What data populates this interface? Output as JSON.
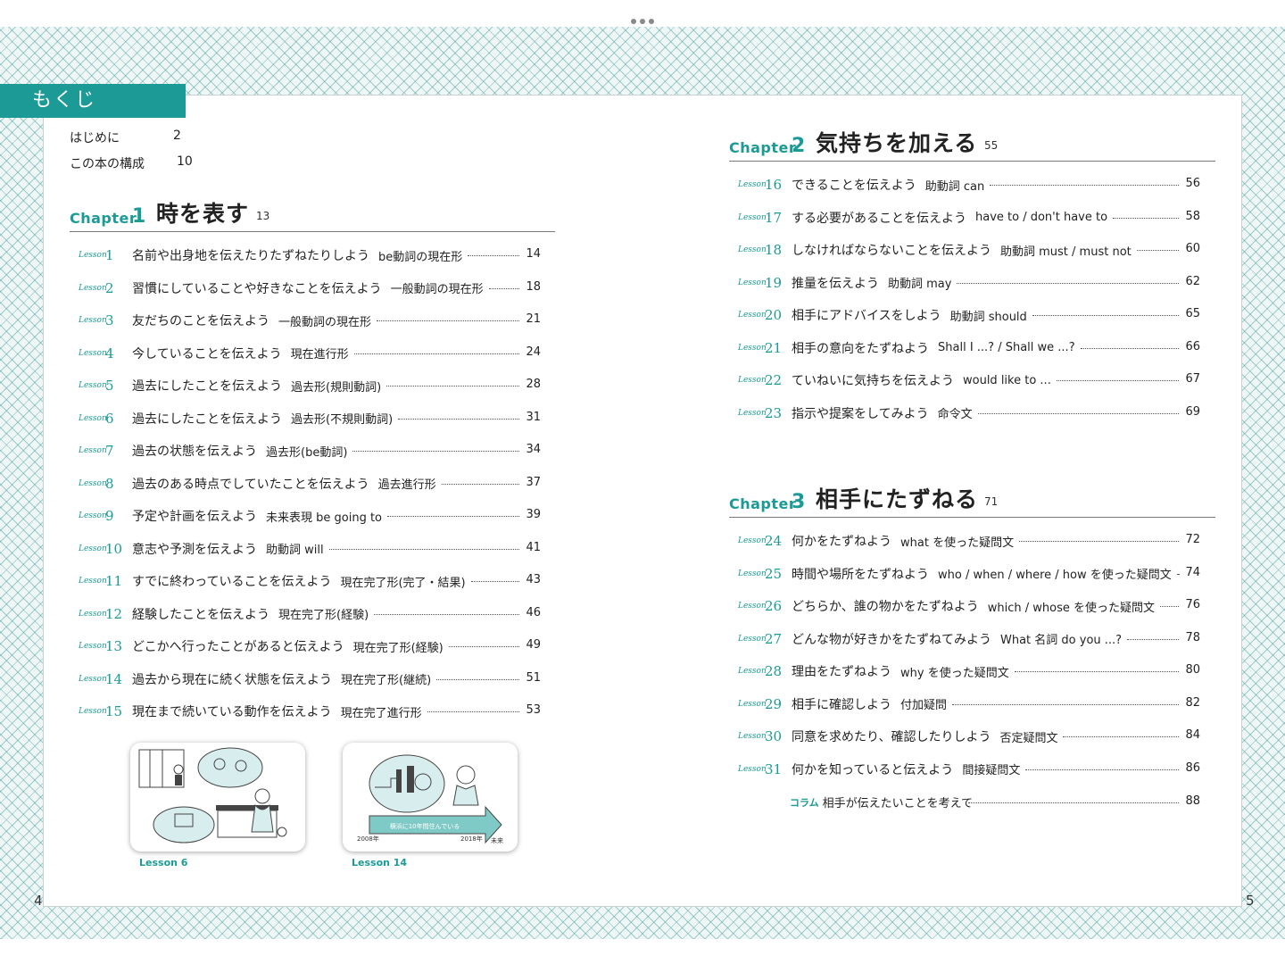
{
  "header": {
    "label": "もくじ"
  },
  "page_numbers": {
    "left": "4",
    "right": "5"
  },
  "intro": [
    {
      "title": "はじめに",
      "page": "2"
    },
    {
      "title": "この本の構成",
      "page": "10"
    }
  ],
  "lesson_word": "Lesson",
  "chapters": [
    {
      "chapter_word": "Chapter",
      "number": "1",
      "title": "時を表す",
      "page": "13",
      "lessons": [
        {
          "num": "1",
          "title": "名前や出身地を伝えたりたずねたりしよう",
          "grammar": "be動詞の現在形",
          "page": "14"
        },
        {
          "num": "2",
          "title": "習慣にしていることや好きなことを伝えよう",
          "grammar": "一般動詞の現在形",
          "page": "18"
        },
        {
          "num": "3",
          "title": "友だちのことを伝えよう",
          "grammar": "一般動詞の現在形",
          "page": "21"
        },
        {
          "num": "4",
          "title": "今していることを伝えよう",
          "grammar": "現在進行形",
          "page": "24"
        },
        {
          "num": "5",
          "title": "過去にしたことを伝えよう",
          "grammar": "過去形(規則動詞)",
          "page": "28"
        },
        {
          "num": "6",
          "title": "過去にしたことを伝えよう",
          "grammar": "過去形(不規則動詞)",
          "page": "31"
        },
        {
          "num": "7",
          "title": "過去の状態を伝えよう",
          "grammar": "過去形(be動詞)",
          "page": "34"
        },
        {
          "num": "8",
          "title": "過去のある時点でしていたことを伝えよう",
          "grammar": "過去進行形",
          "page": "37"
        },
        {
          "num": "9",
          "title": "予定や計画を伝えよう",
          "grammar": "未来表現 be going to",
          "page": "39"
        },
        {
          "num": "10",
          "title": "意志や予測を伝えよう",
          "grammar": "助動詞 will",
          "page": "41"
        },
        {
          "num": "11",
          "title": "すでに終わっていることを伝えよう",
          "grammar": "現在完了形(完了・結果)",
          "page": "43"
        },
        {
          "num": "12",
          "title": "経験したことを伝えよう",
          "grammar": "現在完了形(経験)",
          "page": "46"
        },
        {
          "num": "13",
          "title": "どこかへ行ったことがあると伝えよう",
          "grammar": "現在完了形(経験)",
          "page": "49"
        },
        {
          "num": "14",
          "title": "過去から現在に続く状態を伝えよう",
          "grammar": "現在完了形(継続)",
          "page": "51"
        },
        {
          "num": "15",
          "title": "現在まで続いている動作を伝えよう",
          "grammar": "現在完了進行形",
          "page": "53"
        }
      ]
    },
    {
      "chapter_word": "Chapter",
      "number": "2",
      "title": "気持ちを加える",
      "page": "55",
      "lessons": [
        {
          "num": "16",
          "title": "できることを伝えよう",
          "grammar": "助動詞 can",
          "page": "56"
        },
        {
          "num": "17",
          "title": "する必要があることを伝えよう",
          "grammar": "have to / don't have to",
          "page": "58"
        },
        {
          "num": "18",
          "title": "しなければならないことを伝えよう",
          "grammar": "助動詞 must / must not",
          "page": "60"
        },
        {
          "num": "19",
          "title": "推量を伝えよう",
          "grammar": "助動詞 may",
          "page": "62"
        },
        {
          "num": "20",
          "title": "相手にアドバイスをしよう",
          "grammar": "助動詞 should",
          "page": "65"
        },
        {
          "num": "21",
          "title": "相手の意向をたずねよう",
          "grammar": "Shall I ...? / Shall we ...?",
          "page": "66"
        },
        {
          "num": "22",
          "title": "ていねいに気持ちを伝えよう",
          "grammar": "would like to ...",
          "page": "67"
        },
        {
          "num": "23",
          "title": "指示や提案をしてみよう",
          "grammar": "命令文",
          "page": "69"
        }
      ]
    },
    {
      "chapter_word": "Chapter",
      "number": "3",
      "title": "相手にたずねる",
      "page": "71",
      "lessons": [
        {
          "num": "24",
          "title": "何かをたずねよう",
          "grammar": "what を使った疑問文",
          "page": "72"
        },
        {
          "num": "25",
          "title": "時間や場所をたずねよう",
          "grammar": "who / when / where / how を使った疑問文",
          "page": "74"
        },
        {
          "num": "26",
          "title": "どちらか、誰の物かをたずねよう",
          "grammar": "which / whose を使った疑問文",
          "page": "76"
        },
        {
          "num": "27",
          "title": "どんな物が好きかをたずねてみよう",
          "grammar": "What 名詞 do you ...?",
          "page": "78"
        },
        {
          "num": "28",
          "title": "理由をたずねよう",
          "grammar": "why を使った疑問文",
          "page": "80"
        },
        {
          "num": "29",
          "title": "相手に確認しよう",
          "grammar": "付加疑問",
          "page": "82"
        },
        {
          "num": "30",
          "title": "同意を求めたり、確認したりしよう",
          "grammar": "否定疑問文",
          "page": "84"
        },
        {
          "num": "31",
          "title": "何かを知っていると伝えよう",
          "grammar": "間接疑問文",
          "page": "86"
        }
      ],
      "column": {
        "label": "コラム",
        "title": "相手が伝えたいことを考えて",
        "page": "88"
      }
    }
  ],
  "illustrations": [
    {
      "caption": "Lesson 6"
    },
    {
      "caption": "Lesson 14",
      "banner": "横浜に10年間住んでいる",
      "year_start": "2008年",
      "year_end": "2018年",
      "future": "未来"
    }
  ],
  "colors": {
    "accent": "#1b9a96",
    "pattern": "#3c9696"
  }
}
